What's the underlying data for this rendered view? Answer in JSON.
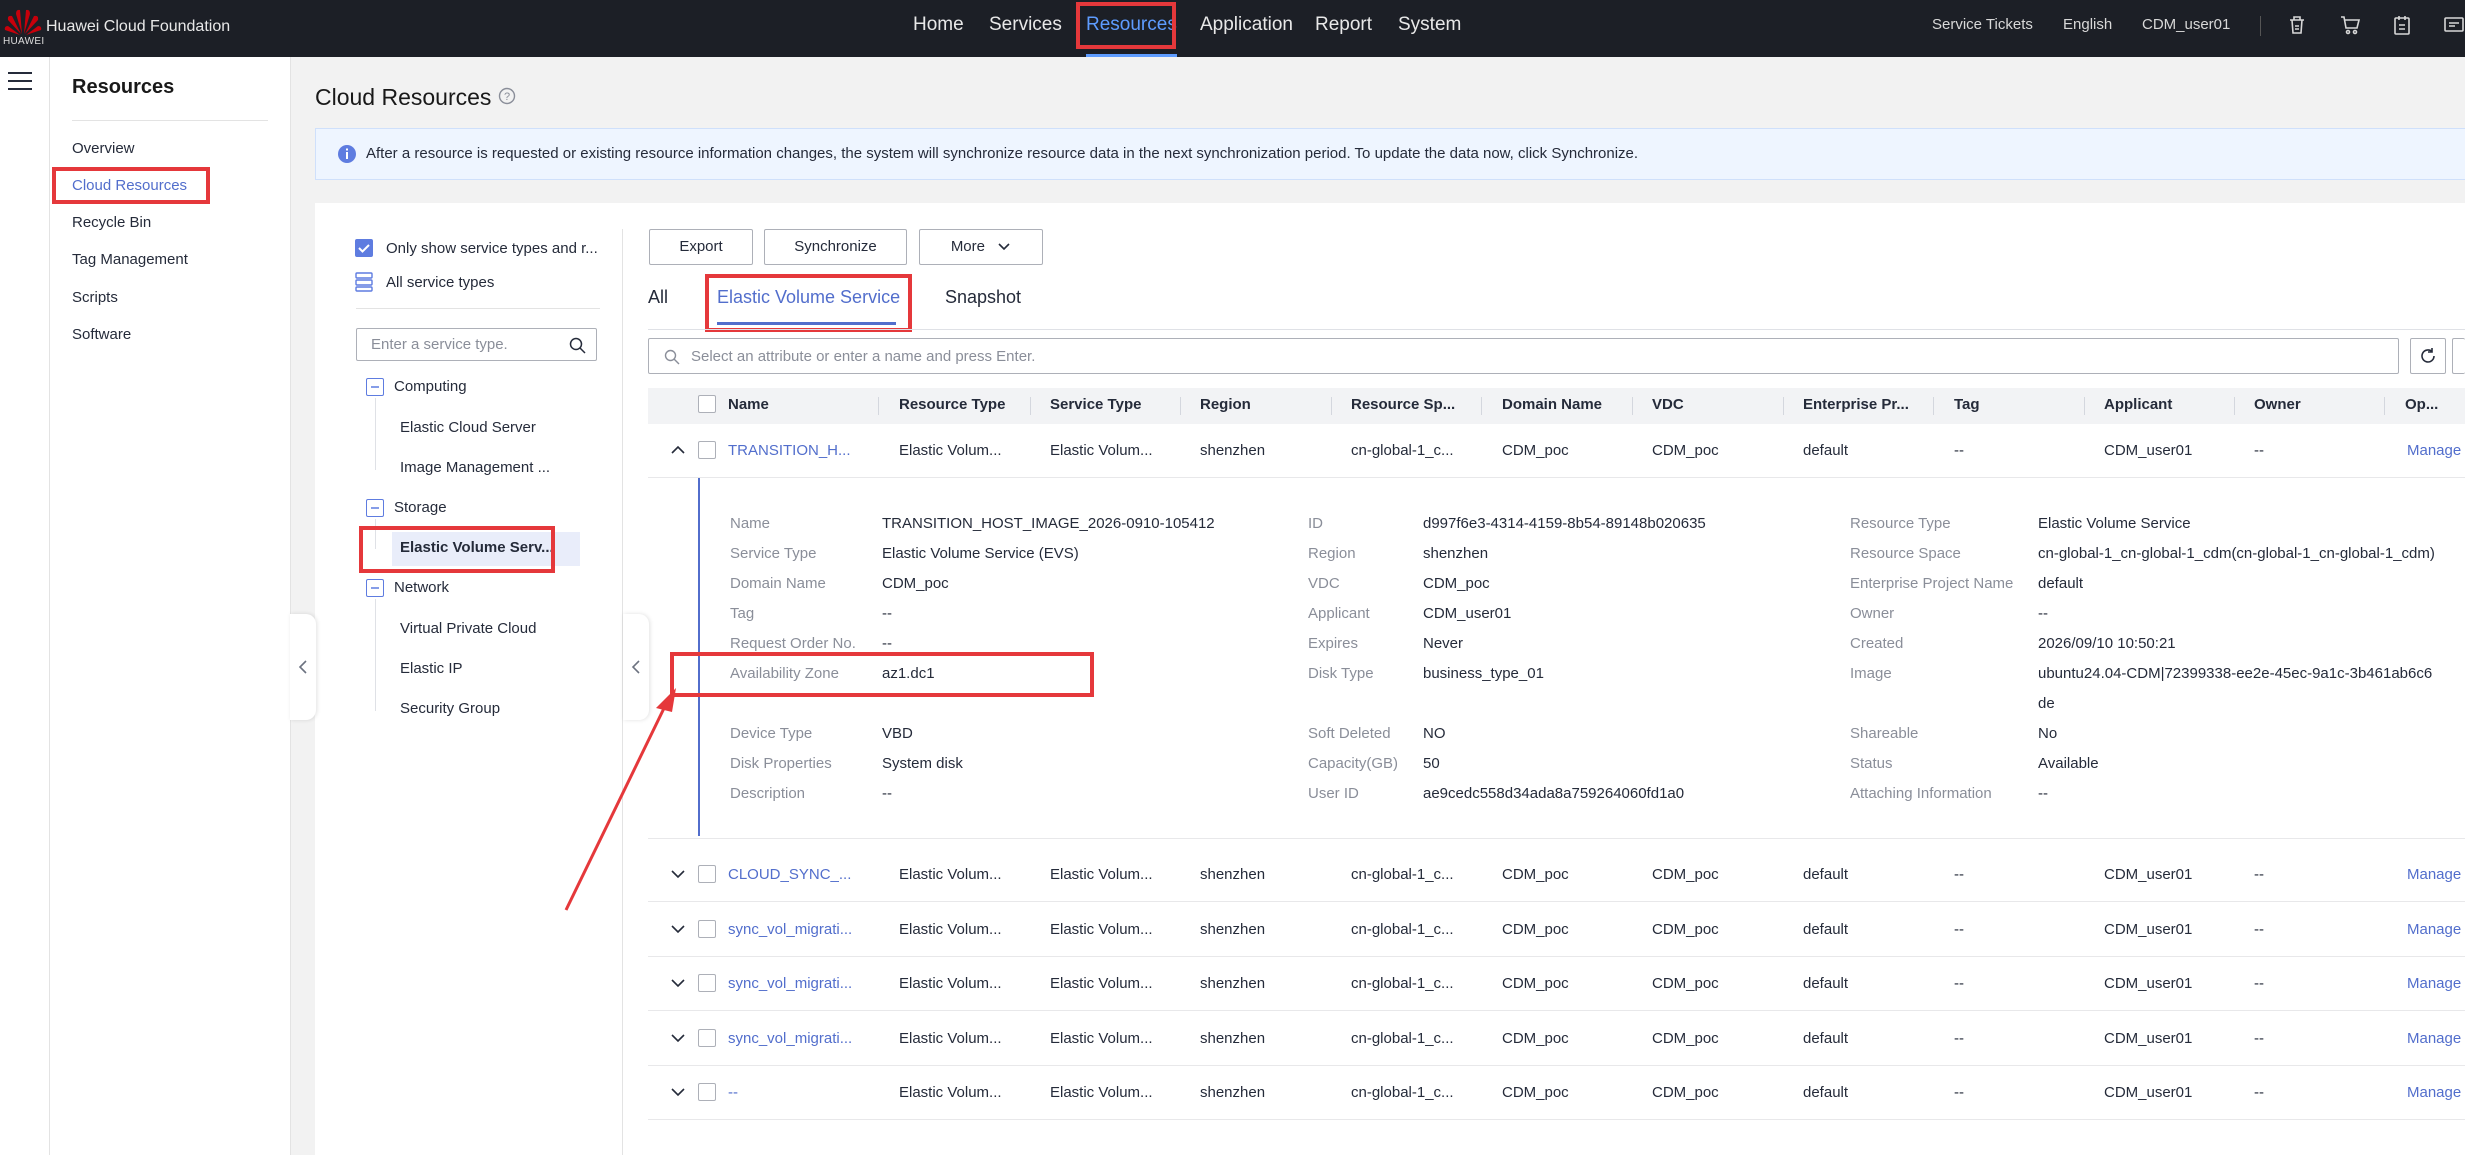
{
  "brand": {
    "name": "Huawei Cloud Foundation",
    "mark_text": "HUAWEI"
  },
  "topnav": {
    "items": [
      "Home",
      "Services",
      "Resources",
      "Application",
      "Report",
      "System"
    ],
    "active": "Resources"
  },
  "topright": {
    "tickets": "Service Tickets",
    "language": "English",
    "user": "CDM_user01"
  },
  "sidebar": {
    "title": "Resources",
    "items": [
      "Overview",
      "Cloud Resources",
      "Recycle Bin",
      "Tag Management",
      "Scripts",
      "Software"
    ],
    "active": "Cloud Resources"
  },
  "page": {
    "title": "Cloud Resources",
    "notice": "After a resource is requested or existing resource information changes, the system will synchronize resource data in the next synchronization period. To update the data now, click Synchronize."
  },
  "types": {
    "only_show": "Only show service types and r...",
    "all": "All service types",
    "search_placeholder": "Enter a service type.",
    "groups": [
      {
        "name": "Computing",
        "items": [
          "Elastic Cloud Server",
          "Image Management ..."
        ]
      },
      {
        "name": "Storage",
        "items": [
          "Elastic Volume Serv..."
        ]
      },
      {
        "name": "Network",
        "items": [
          "Virtual Private Cloud",
          "Elastic IP",
          "Security Group"
        ]
      }
    ]
  },
  "toolbar": {
    "export": "Export",
    "sync": "Synchronize",
    "more": "More"
  },
  "tabs": {
    "items": [
      "All",
      "Elastic Volume Service",
      "Snapshot"
    ],
    "active": "Elastic Volume Service"
  },
  "filter": {
    "placeholder": "Select an attribute or enter a name and press Enter."
  },
  "table": {
    "columns": [
      "Name",
      "Resource Type",
      "Service Type",
      "Region",
      "Resource Sp...",
      "Domain Name",
      "VDC",
      "Enterprise Pr...",
      "Tag",
      "Applicant",
      "Owner",
      "Op..."
    ],
    "rows": [
      {
        "name": "TRANSITION_H...",
        "rtype": "Elastic Volum...",
        "stype": "Elastic Volum...",
        "region": "shenzhen",
        "space": "cn-global-1_c...",
        "domain": "CDM_poc",
        "vdc": "CDM_poc",
        "ep": "default",
        "tag": "--",
        "applicant": "CDM_user01",
        "owner": "--",
        "op": "Manage",
        "expanded": true
      },
      {
        "name": "CLOUD_SYNC_...",
        "rtype": "Elastic Volum...",
        "stype": "Elastic Volum...",
        "region": "shenzhen",
        "space": "cn-global-1_c...",
        "domain": "CDM_poc",
        "vdc": "CDM_poc",
        "ep": "default",
        "tag": "--",
        "applicant": "CDM_user01",
        "owner": "--",
        "op": "Manage"
      },
      {
        "name": "sync_vol_migrati...",
        "rtype": "Elastic Volum...",
        "stype": "Elastic Volum...",
        "region": "shenzhen",
        "space": "cn-global-1_c...",
        "domain": "CDM_poc",
        "vdc": "CDM_poc",
        "ep": "default",
        "tag": "--",
        "applicant": "CDM_user01",
        "owner": "--",
        "op": "Manage"
      },
      {
        "name": "sync_vol_migrati...",
        "rtype": "Elastic Volum...",
        "stype": "Elastic Volum...",
        "region": "shenzhen",
        "space": "cn-global-1_c...",
        "domain": "CDM_poc",
        "vdc": "CDM_poc",
        "ep": "default",
        "tag": "--",
        "applicant": "CDM_user01",
        "owner": "--",
        "op": "Manage"
      },
      {
        "name": "sync_vol_migrati...",
        "rtype": "Elastic Volum...",
        "stype": "Elastic Volum...",
        "region": "shenzhen",
        "space": "cn-global-1_c...",
        "domain": "CDM_poc",
        "vdc": "CDM_poc",
        "ep": "default",
        "tag": "--",
        "applicant": "CDM_user01",
        "owner": "--",
        "op": "Manage"
      },
      {
        "name": "--",
        "rtype": "Elastic Volum...",
        "stype": "Elastic Volum...",
        "region": "shenzhen",
        "space": "cn-global-1_c...",
        "domain": "CDM_poc",
        "vdc": "CDM_poc",
        "ep": "default",
        "tag": "--",
        "applicant": "CDM_user01",
        "owner": "--",
        "op": "Manage"
      }
    ]
  },
  "detail": {
    "col1": [
      [
        "Name",
        "TRANSITION_HOST_IMAGE_2026-0910-105412"
      ],
      [
        "Service Type",
        "Elastic Volume Service (EVS)"
      ],
      [
        "Domain Name",
        "CDM_poc"
      ],
      [
        "Tag",
        "--"
      ],
      [
        "Request Order No.",
        "--"
      ],
      [
        "Availability Zone",
        "az1.dc1"
      ],
      [
        "Device Type",
        "VBD"
      ],
      [
        "Disk Properties",
        "System disk"
      ],
      [
        "Description",
        "--"
      ]
    ],
    "col2": [
      [
        "ID",
        "d997f6e3-4314-4159-8b54-89148b020635"
      ],
      [
        "Region",
        "shenzhen"
      ],
      [
        "VDC",
        "CDM_poc"
      ],
      [
        "Applicant",
        "CDM_user01"
      ],
      [
        "Expires",
        "Never"
      ],
      [
        "Disk Type",
        "business_type_01"
      ],
      [
        "Soft Deleted",
        "NO"
      ],
      [
        "Capacity(GB)",
        "50"
      ],
      [
        "User ID",
        "ae9cedc558d34ada8a759264060fd1a0"
      ]
    ],
    "col3": [
      [
        "Resource Type",
        "Elastic Volume Service"
      ],
      [
        "Resource Space",
        "cn-global-1_cn-global-1_cdm(cn-global-1_cn-global-1_cdm)"
      ],
      [
        "Enterprise Project Name",
        "default"
      ],
      [
        "Owner",
        "--"
      ],
      [
        "Created",
        "2026/09/10 10:50:21"
      ],
      [
        "Image",
        "ubuntu24.04-CDM|72399338-ee2e-45ec-9a1c-3b461ab6c6",
        "de"
      ],
      [
        "Shareable",
        "No"
      ],
      [
        "Status",
        "Available"
      ],
      [
        "Attaching Information",
        "--"
      ]
    ]
  },
  "colors": {
    "accent": "#526ecc",
    "topbar": "#1c1f26",
    "annotation": "#e5383b",
    "brand": "#c7000b"
  }
}
